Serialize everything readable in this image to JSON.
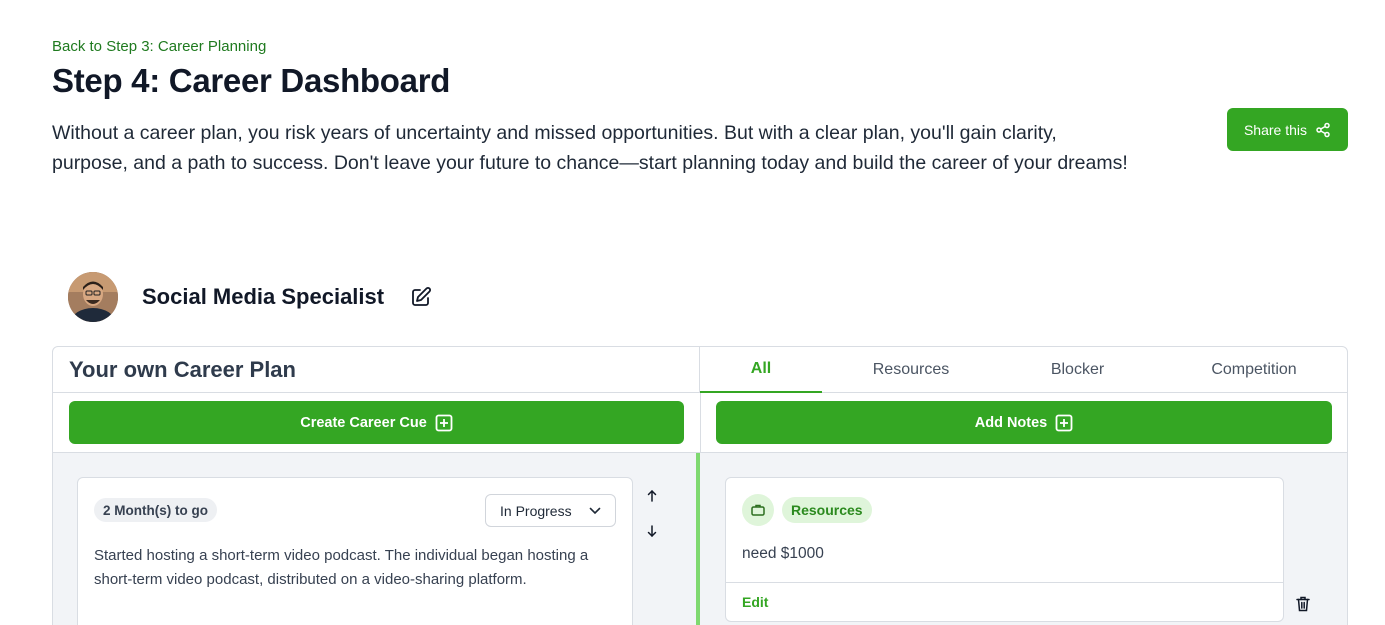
{
  "header": {
    "back_link": "Back to Step 3: Career Planning",
    "title": "Step 4: Career Dashboard",
    "intro": "Without a career plan, you risk years of uncertainty and missed opportunities. But with a clear plan, you'll gain clarity, purpose, and a path to success. Don't leave your future to chance—start planning today and build the career of your dreams!",
    "share_label": "Share this"
  },
  "profile": {
    "career_name": "Social Media Specialist",
    "icons": {
      "edit": "pencil-square-icon"
    }
  },
  "plan": {
    "title": "Your own Career Plan",
    "create_label": "Create Career Cue",
    "cue": {
      "time_left": "2 Month(s) to go",
      "status": "In Progress",
      "description": "Started hosting a short-term video podcast. The individual began hosting a short-term video podcast, distributed on a video-sharing platform."
    }
  },
  "notes": {
    "tabs": [
      {
        "label": "All",
        "active": true
      },
      {
        "label": "Resources",
        "active": false
      },
      {
        "label": "Blocker",
        "active": false
      },
      {
        "label": "Competition",
        "active": false
      }
    ],
    "add_label": "Add Notes",
    "note": {
      "tag": "Resources",
      "text": "need $1000",
      "edit_label": "Edit",
      "icon": "briefcase-icon"
    }
  },
  "colors": {
    "primary": "#34a623",
    "link": "#1f7a1f",
    "accent_line": "#7fd970",
    "tag_bg": "#dff5da",
    "content_bg": "#f2f4f7"
  }
}
